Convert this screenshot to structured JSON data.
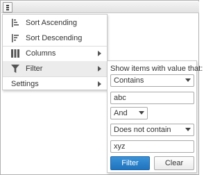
{
  "menu": {
    "sort_ascending": "Sort Ascending",
    "sort_descending": "Sort Descending",
    "columns": "Columns",
    "filter": "Filter",
    "settings": "Settings"
  },
  "filter_panel": {
    "title": "Show items with value that:",
    "operator1": "Contains",
    "value1": "abc",
    "logic": "And",
    "operator2": "Does not contain",
    "value2": "xyz",
    "filter_button": "Filter",
    "clear_button": "Clear"
  },
  "colors": {
    "accent": "#2a84cc",
    "menu_active": "#ececec"
  }
}
